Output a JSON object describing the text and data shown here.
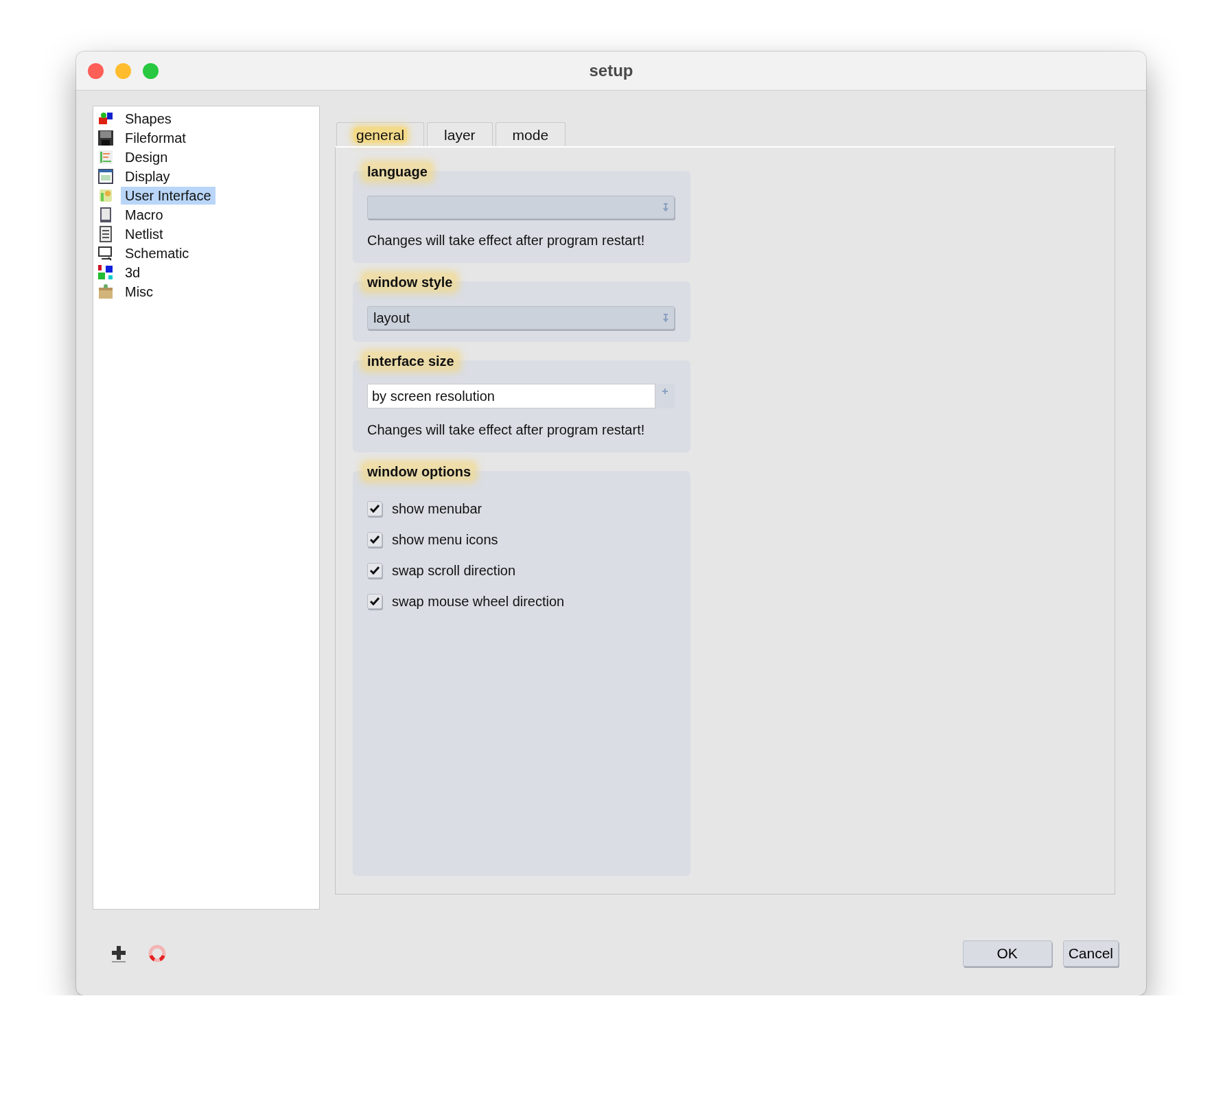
{
  "window": {
    "title": "setup"
  },
  "sidebar": {
    "items": [
      {
        "label": "Shapes",
        "selected": false
      },
      {
        "label": "Fileformat",
        "selected": false
      },
      {
        "label": "Design",
        "selected": false
      },
      {
        "label": "Display",
        "selected": false
      },
      {
        "label": "User Interface",
        "selected": true
      },
      {
        "label": "Macro",
        "selected": false
      },
      {
        "label": "Netlist",
        "selected": false
      },
      {
        "label": "Schematic",
        "selected": false
      },
      {
        "label": "3d",
        "selected": false
      },
      {
        "label": "Misc",
        "selected": false
      }
    ]
  },
  "tabs": [
    {
      "label": "general",
      "selected": true
    },
    {
      "label": "layer",
      "selected": false
    },
    {
      "label": "mode",
      "selected": false
    }
  ],
  "groups": [
    {
      "kind": "select",
      "title": "language",
      "note": "Changes will take effect after program restart!"
    },
    {
      "kind": "select",
      "title": "window style",
      "value": "layout"
    },
    {
      "kind": "combo",
      "title": "interface size",
      "value": "by screen resolution",
      "note": "Changes will take effect after program restart!"
    },
    {
      "kind": "checks",
      "title": "window options",
      "options": [
        {
          "label": "show menubar",
          "checked": true
        },
        {
          "label": "show menu icons",
          "checked": true
        },
        {
          "label": "swap scroll direction",
          "checked": true
        },
        {
          "label": "swap mouse wheel direction",
          "checked": true
        }
      ]
    }
  ],
  "buttons": [
    {
      "label": "OK"
    },
    {
      "label": "Cancel"
    }
  ]
}
